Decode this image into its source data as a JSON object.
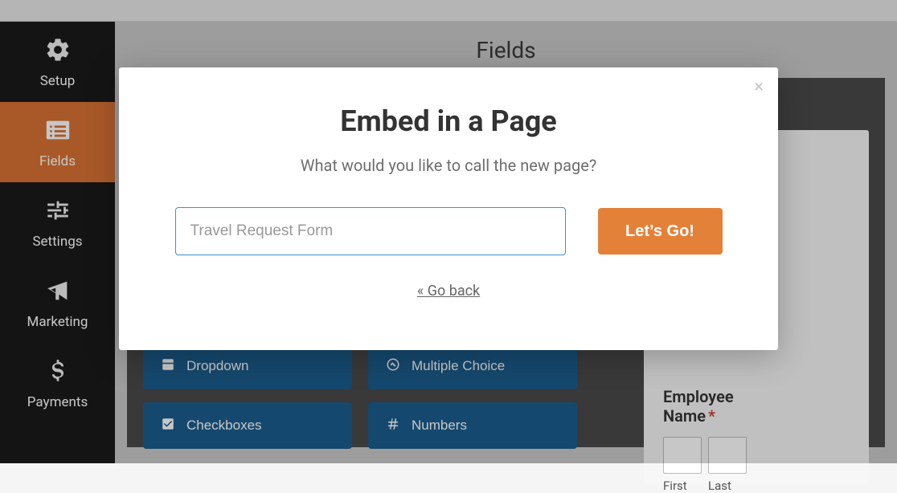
{
  "page": {
    "header_title": "Fields"
  },
  "sidebar": {
    "items": [
      {
        "label": "Setup",
        "name": "sidebar-item-setup"
      },
      {
        "label": "Fields",
        "name": "sidebar-item-fields"
      },
      {
        "label": "Settings",
        "name": "sidebar-item-settings"
      },
      {
        "label": "Marketing",
        "name": "sidebar-item-marketing"
      },
      {
        "label": "Payments",
        "name": "sidebar-item-payments"
      }
    ]
  },
  "fields": {
    "dropdown": "Dropdown",
    "multiple_choice": "Multiple Choice",
    "checkboxes": "Checkboxes",
    "numbers": "Numbers"
  },
  "preview": {
    "label_part1": "Employee",
    "label_part2": "Name",
    "required_mark": "*",
    "first": "First",
    "last": "Last"
  },
  "modal": {
    "title": "Embed in a Page",
    "subtitle": "What would you like to call the new page?",
    "input_placeholder": "Travel Request Form",
    "submit_label": "Let’s Go!",
    "go_back": "« Go back",
    "close_symbol": "×"
  }
}
